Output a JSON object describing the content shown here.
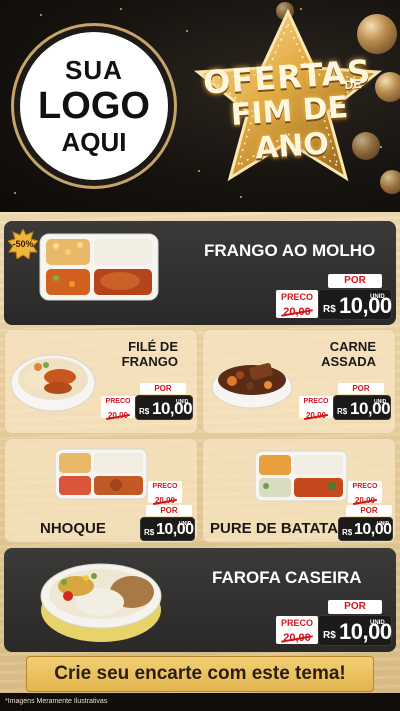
{
  "logo": {
    "line1": "SUA",
    "line2": "LOGO",
    "line3": "AQUI"
  },
  "header": {
    "title_line1": "OFERTAS",
    "title_de": "DE",
    "title_line2": "FIM DE ANO"
  },
  "badge": {
    "text": "-50%"
  },
  "price_labels": {
    "preco": "PRECO",
    "por": "POR",
    "currency": "R$",
    "unit": "UNID"
  },
  "items": [
    {
      "name": "FRANGO AO MOLHO",
      "old_price": "20,00",
      "new_price": "10,00"
    },
    {
      "name_line1": "FILÉ DE",
      "name_line2": "FRANGO",
      "old_price": "20,00",
      "new_price": "10,00"
    },
    {
      "name_line1": "CARNE",
      "name_line2": "ASSADA",
      "old_price": "20,00",
      "new_price": "10,00"
    },
    {
      "name": "NHOQUE",
      "old_price": "20,00",
      "new_price": "10,00"
    },
    {
      "name": "PURE DE BATATA",
      "old_price": "20,00",
      "new_price": "10,00"
    },
    {
      "name": "FAROFA CASEIRA",
      "old_price": "20,00",
      "new_price": "10,00"
    }
  ],
  "cta": {
    "text": "Crie seu encarte com este tema!"
  },
  "disclaimer": "*Imagens Meramente Ilustrativas",
  "colors": {
    "accent_red": "#d1171b",
    "gold": "#e2b54f",
    "dark_panel": "#2f2e2c",
    "wood": "#ead1a0"
  }
}
